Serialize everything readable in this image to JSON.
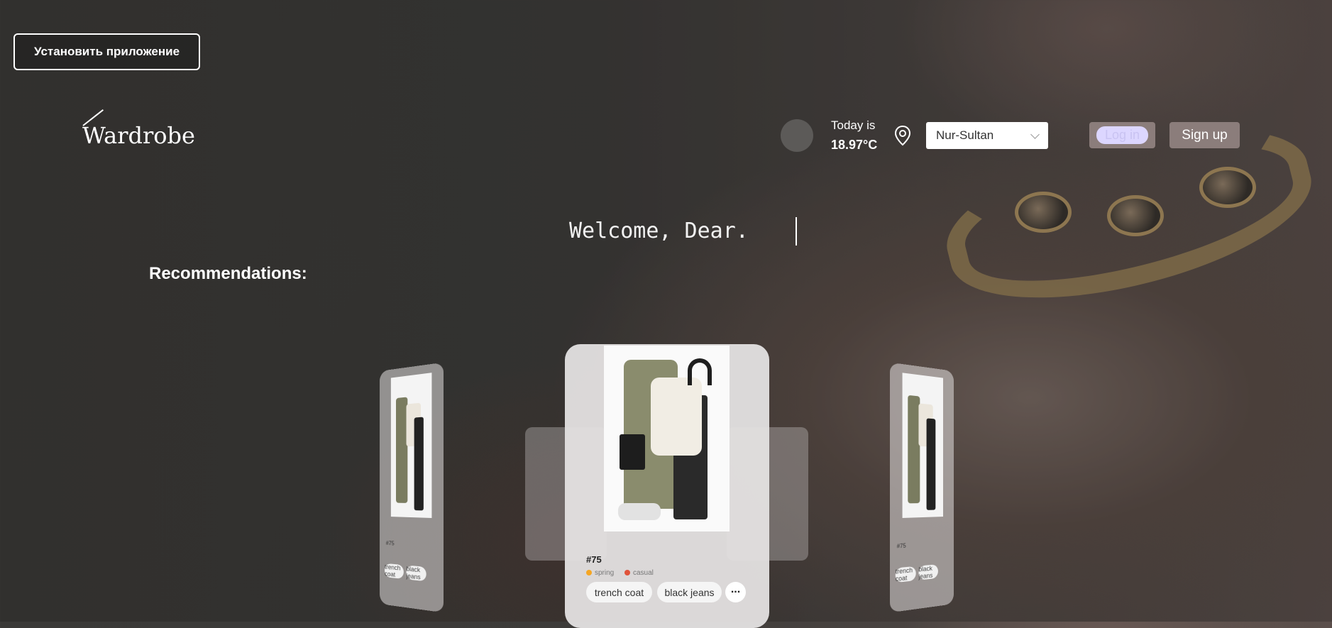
{
  "header": {
    "install_label": "Установить приложение",
    "logo": "Wardrobe",
    "today_label": "Today is",
    "temperature": "18.97°C",
    "city": "Nur-Sultan",
    "login_label": "Log in",
    "signup_label": "Sign up"
  },
  "hero": {
    "welcome": "Welcome, Dear.",
    "recommendations_title": "Recommendations:"
  },
  "cards": {
    "main": {
      "id": "#75",
      "season": "spring",
      "style": "casual",
      "items": [
        "trench coat",
        "black jeans"
      ],
      "more": "..."
    },
    "side": {
      "id": "#75",
      "items": [
        "trench coat",
        "black jeans"
      ]
    }
  },
  "colors": {
    "season_dot": "#f5a623",
    "style_dot": "#e0533a"
  }
}
